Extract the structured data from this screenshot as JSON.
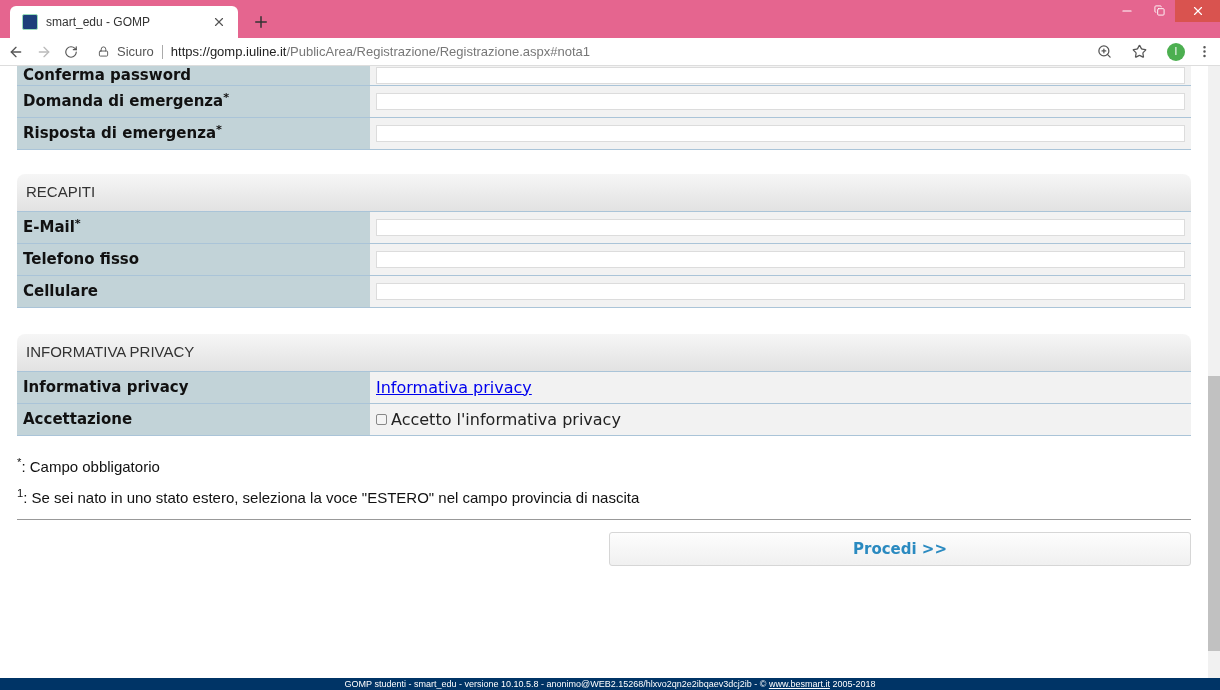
{
  "browser": {
    "tab_title": "smart_edu - GOMP",
    "security": "Sicuro",
    "url_host": "https://gomp.iuline.it",
    "url_path": "/PublicArea/Registrazione/Registrazione.aspx#nota1",
    "profile_initial": "I"
  },
  "sections": [
    {
      "rows": [
        {
          "label": "Conferma password",
          "kind": "input"
        },
        {
          "label": "Domanda di emergenza$^{*}$",
          "kind": "input"
        },
        {
          "label": "Risposta di emergenza$^{*}$",
          "kind": "input"
        }
      ]
    },
    {
      "title": "RECAPITI",
      "rows": [
        {
          "label": "E-Mail$^{*}$",
          "kind": "input"
        },
        {
          "label": "Telefono fisso",
          "kind": "input"
        },
        {
          "label": "Cellulare",
          "kind": "input"
        }
      ]
    },
    {
      "title": "INFORMATIVA PRIVACY",
      "rows": [
        {
          "label": "Informativa privacy",
          "kind": "link",
          "text": "Informativa privacy"
        },
        {
          "label": "Accettazione",
          "kind": "checkbox",
          "text": "Accetto l'informativa privacy",
          "checked": false
        }
      ]
    }
  ],
  "notes": [
    "$^{*}$: Campo obbligatorio",
    "$^{1}$: Se sei nato in uno stato estero, seleziona la voce \"ESTERO\" nel campo provincia di nascita"
  ],
  "submit": "Procedi >>",
  "footer": {
    "text": "GOMP studenti - smart_edu - versione 10.10.5.8 - anonimo@WEB2.15268/hlxvo2qn2e2ibqaev3dcj2ib - © ",
    "link": "www.besmart.it",
    "suffix": " 2005-2018"
  }
}
